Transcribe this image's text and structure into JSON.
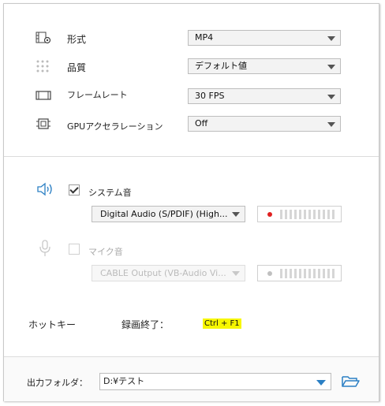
{
  "video": {
    "format": {
      "label": "形式",
      "value": "MP4",
      "icon": "format-settings-icon"
    },
    "quality": {
      "label": "品質",
      "value": "デフォルト値",
      "icon": "quality-dots-icon"
    },
    "framerate": {
      "label": "フレームレート",
      "value": "30 FPS",
      "icon": "film-strip-icon"
    },
    "gpu": {
      "label": "GPUアクセラレーション",
      "value": "Off",
      "icon": "chip-icon"
    }
  },
  "audio": {
    "system": {
      "label": "システム音",
      "checked": true,
      "device": "Digital Audio (S/PDIF) (High...",
      "icon": "speaker-icon",
      "indicator_color": "#e02020"
    },
    "mic": {
      "label": "マイク音",
      "checked": false,
      "device": "CABLE Output (VB-Audio Vi...",
      "icon": "microphone-icon",
      "indicator_color": "#c0c0c0"
    }
  },
  "hotkey": {
    "section_label": "ホットキー",
    "action_label": "録画終了：",
    "keys": "Ctrl + F1"
  },
  "output": {
    "label": "出力フォルダ：",
    "path": "D:¥テスト",
    "folder_icon": "folder-open-icon"
  },
  "colors": {
    "accent": "#2b7fc4",
    "hotkey_highlight": "#f7f700"
  }
}
